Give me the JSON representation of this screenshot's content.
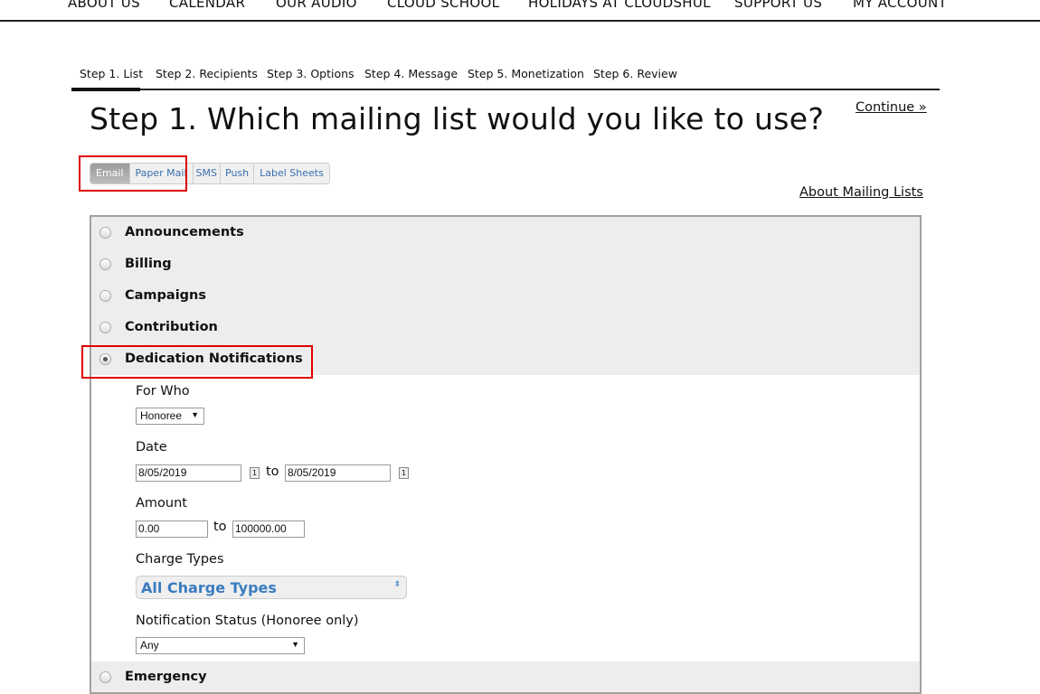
{
  "topnav": [
    "ABOUT US",
    "CALENDAR",
    "OUR AUDIO",
    "CLOUD SCHOOL",
    "HOLIDAYS AT CLOUDSHUL",
    "SUPPORT US",
    "MY ACCOUNT"
  ],
  "tabs": [
    "Step 1. List",
    "Step 2. Recipients",
    "Step 3. Options",
    "Step 4. Message",
    "Step 5. Monetization",
    "Step 6. Review"
  ],
  "title": "Step 1. Which mailing list would you like to use?",
  "continue": "Continue »",
  "channels": [
    "Email",
    "Paper Mail",
    "SMS",
    "Push",
    "Label Sheets"
  ],
  "about_link": "About Mailing Lists",
  "lists": [
    "Announcements",
    "Billing",
    "Campaigns",
    "Contribution",
    "Dedication Notifications",
    "Emergency"
  ],
  "selected_list": "Dedication Notifications",
  "form": {
    "for_who_label": "For Who",
    "for_who_value": "Honoree",
    "date_label": "Date",
    "date_from": "8/05/2019",
    "date_to": "8/05/2019",
    "to": "to",
    "amount_label": "Amount",
    "amount_from": "0.00",
    "amount_to": "100000.00",
    "charge_label": "Charge Types",
    "charge_value": "All Charge Types",
    "status_label": "Notification Status (Honoree only)",
    "status_value": "Any"
  }
}
